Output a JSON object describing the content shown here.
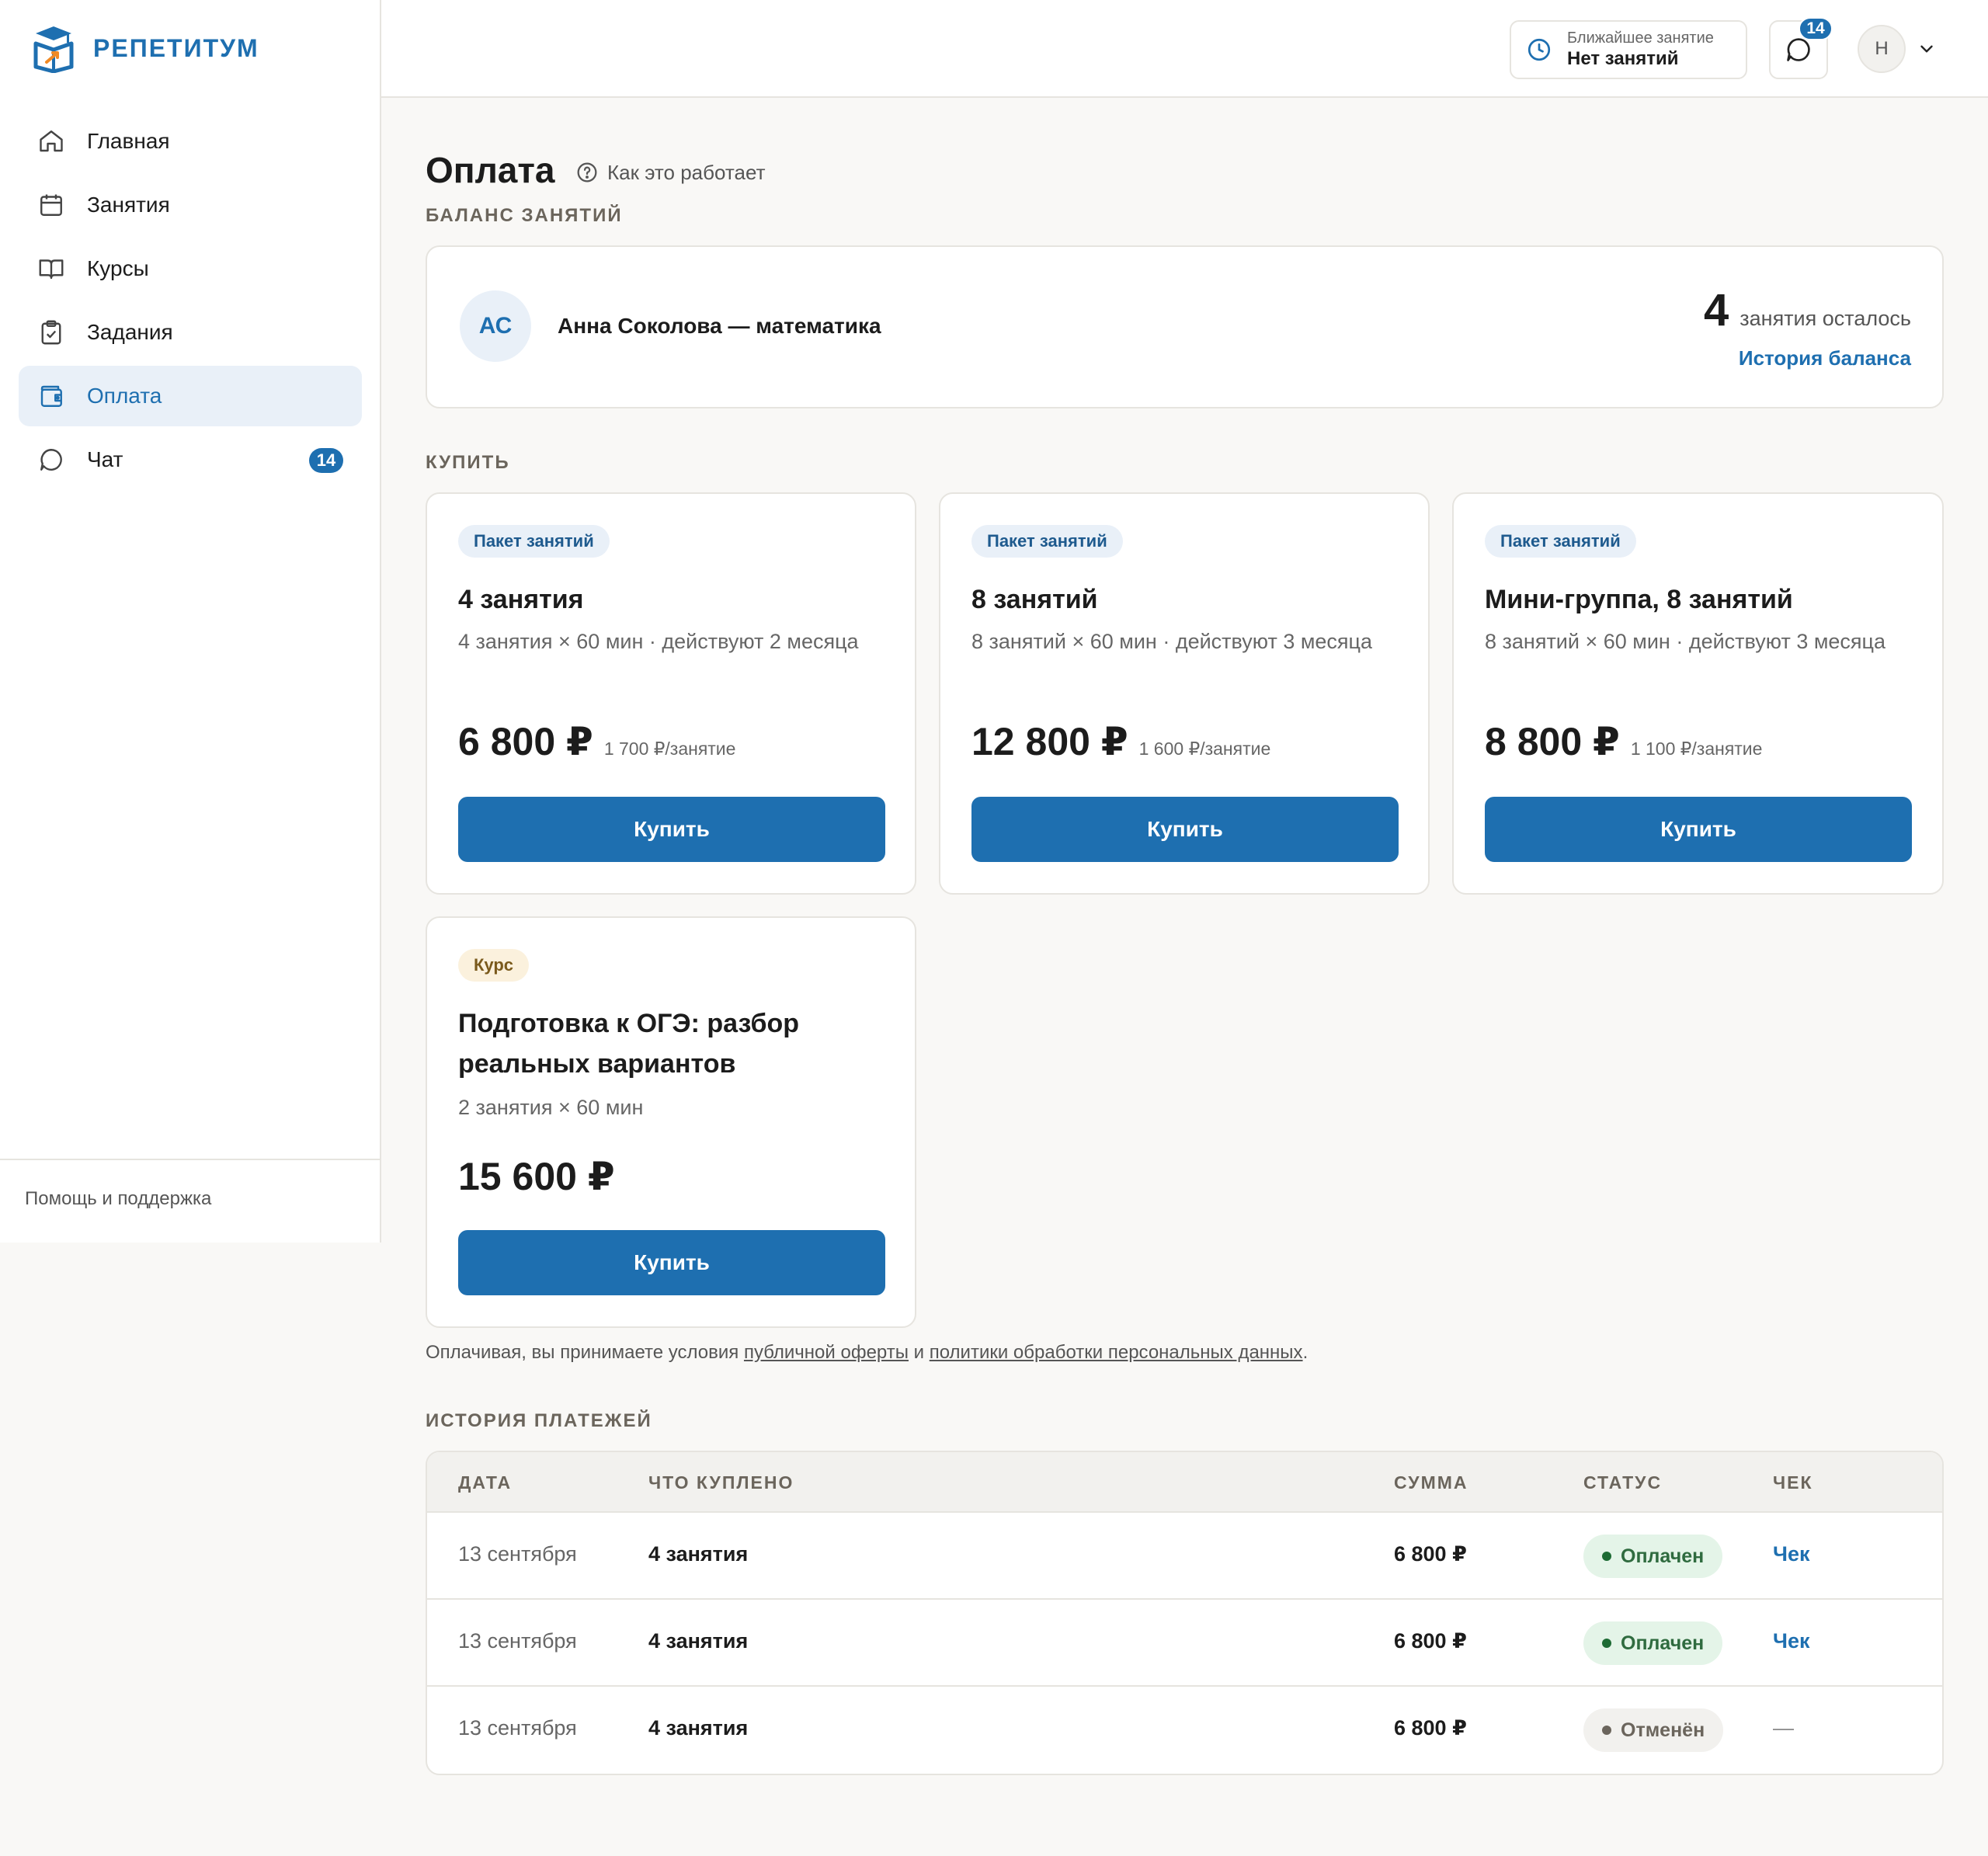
{
  "app": {
    "name": "РЕПЕТИТУМ"
  },
  "sidebar": {
    "items": [
      {
        "label": "Главная",
        "icon": "home-icon"
      },
      {
        "label": "Занятия",
        "icon": "calendar-icon"
      },
      {
        "label": "Курсы",
        "icon": "book-icon"
      },
      {
        "label": "Задания",
        "icon": "clipboard-icon"
      },
      {
        "label": "Оплата",
        "icon": "wallet-icon",
        "active": true
      },
      {
        "label": "Чат",
        "icon": "chat-icon",
        "badge": "14"
      }
    ],
    "footer": "Помощь и поддержка"
  },
  "header": {
    "next_lesson_label": "Ближайшее занятие",
    "next_lesson_value": "Нет занятий",
    "chat_badge": "14",
    "avatar_initial": "Н"
  },
  "page": {
    "title": "Оплата",
    "how_it_works": "Как это работает"
  },
  "balance": {
    "section_label": "БАЛАНС ЗАНЯТИЙ",
    "initials": "АС",
    "name": "Анна Соколова — математика",
    "count": "4",
    "count_text": "занятия осталось",
    "history_link": "История баланса"
  },
  "buy": {
    "section_label": "КУПИТЬ",
    "packages": [
      {
        "tag": "Пакет занятий",
        "title": "4 занятия",
        "desc": "4 занятия × 60 мин · действуют 2 месяца",
        "price": "6 800 ₽",
        "unit": "1 700 ₽/занятие",
        "button": "Купить"
      },
      {
        "tag": "Пакет занятий",
        "title": "8 занятий",
        "desc": "8 занятий × 60 мин · действуют 3 месяца",
        "price": "12 800 ₽",
        "unit": "1 600 ₽/занятие",
        "button": "Купить"
      },
      {
        "tag": "Пакет занятий",
        "title": "Мини-группа, 8 занятий",
        "desc": "8 занятий × 60 мин · действуют 3 месяца",
        "price": "8 800 ₽",
        "unit": "1 100 ₽/занятие",
        "button": "Купить"
      }
    ],
    "course": {
      "tag": "Курс",
      "title_line1": "Подготовка к ОГЭ: разбор",
      "title_line2": "реальных вариантов",
      "desc": "2 занятия × 60 мин",
      "price": "15 600 ₽",
      "button": "Купить"
    }
  },
  "terms": {
    "prefix": "Оплачивая, вы принимаете условия ",
    "offer_link": "публичной оферты",
    "middle": " и ",
    "privacy_link": "политики обработки персональных данных",
    "suffix": "."
  },
  "history": {
    "section_label": "ИСТОРИЯ ПЛАТЕЖЕЙ",
    "columns": {
      "date": "ДАТА",
      "item": "ЧТО КУПЛЕНО",
      "sum": "СУММА",
      "status": "СТАТУС",
      "receipt": "ЧЕК"
    },
    "rows": [
      {
        "date": "13 сентября",
        "item": "4 занятия",
        "sum": "6 800 ₽",
        "status": "Оплачен",
        "receipt": "Чек"
      },
      {
        "date": "13 сентября",
        "item": "4 занятия",
        "sum": "6 800 ₽",
        "status": "Оплачен",
        "receipt": "Чек"
      },
      {
        "date": "13 сентября",
        "item": "4 занятия",
        "sum": "6 800 ₽",
        "status": "Отменён",
        "receipt": "—"
      }
    ]
  },
  "colors": {
    "accent": "#1e6fb0",
    "background": "#f9f8f6",
    "paid": "#1d6b34",
    "course_tag_bg": "#fbf1dd"
  }
}
